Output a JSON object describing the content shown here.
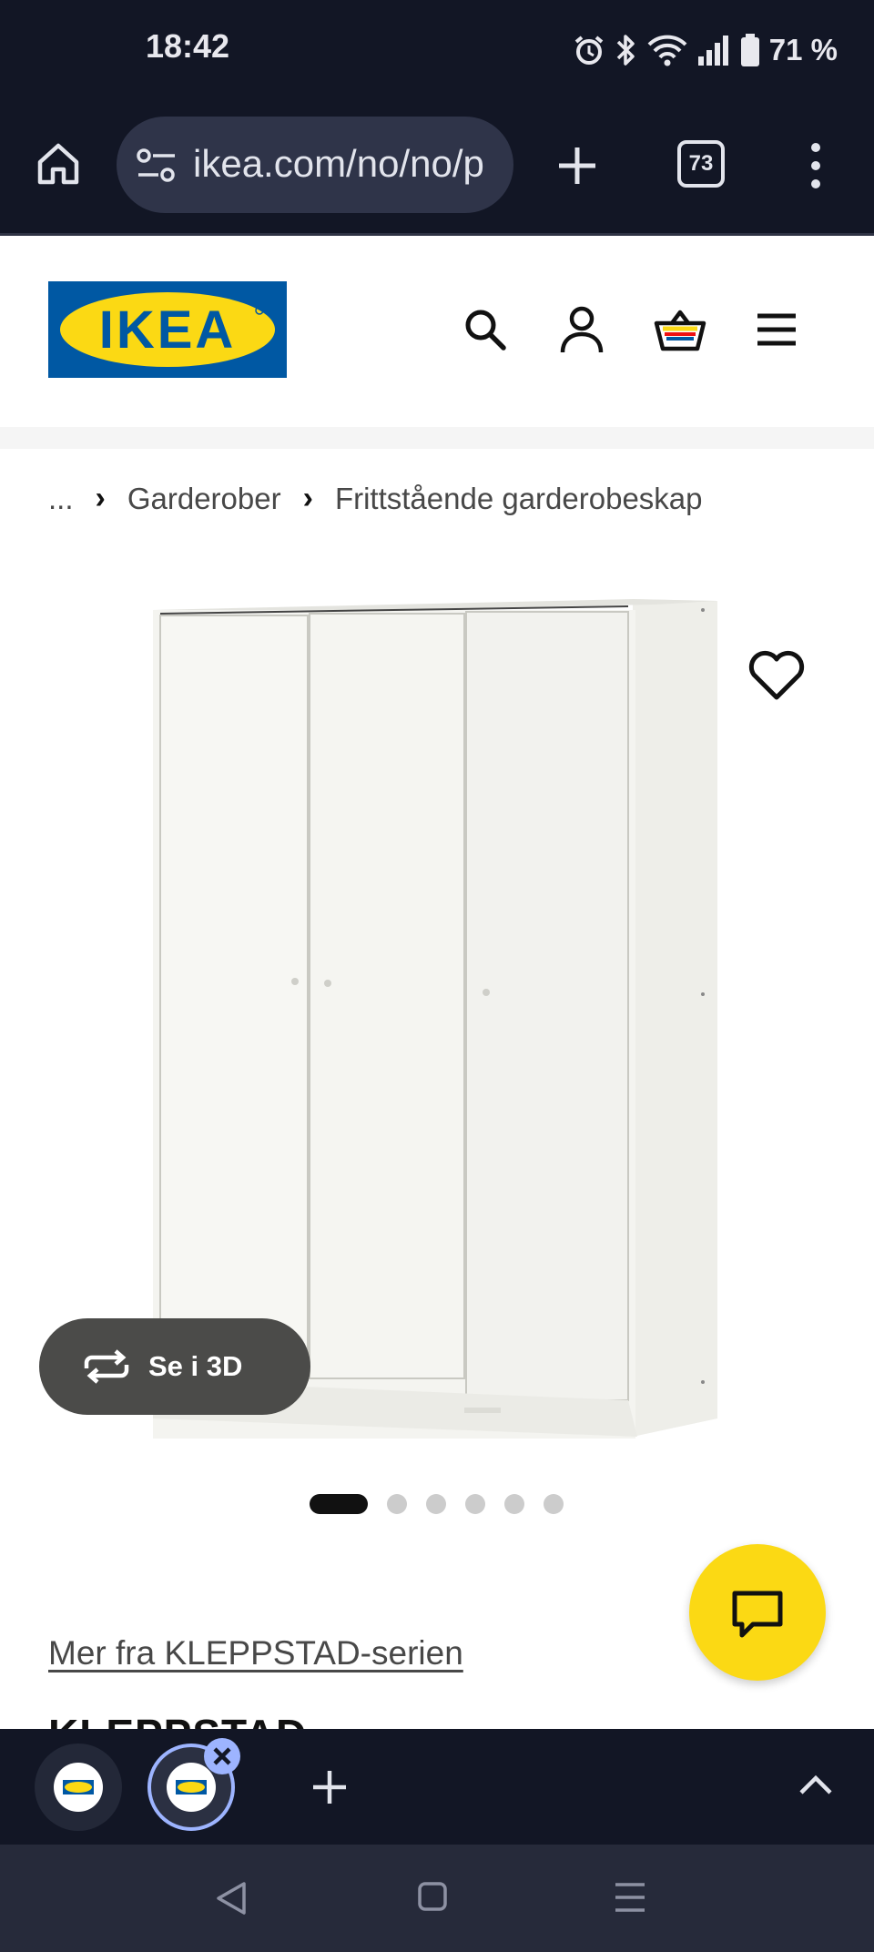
{
  "status_bar": {
    "time": "18:42",
    "battery": "71 %",
    "icons": [
      "alarm-icon",
      "bluetooth-icon",
      "wifi-icon",
      "signal-icon",
      "battery-icon"
    ]
  },
  "browser": {
    "url": "ikea.com/no/no/p",
    "tab_count": "73",
    "icons": [
      "home-icon",
      "site-settings-icon",
      "new-tab-icon",
      "tab-switcher-icon",
      "more-menu-icon"
    ]
  },
  "site_header": {
    "logo_text": "IKEA",
    "icons": [
      "search-icon",
      "account-icon",
      "cart-icon",
      "menu-icon"
    ]
  },
  "breadcrumb": {
    "ellipsis": "...",
    "items": [
      "Garderober",
      "Frittstående garderobeskap"
    ]
  },
  "product": {
    "see_3d_label": "Se i 3D",
    "carousel_count": 6,
    "carousel_active": 0,
    "series_link": "Mer fra KLEPPSTAD-serien",
    "name_peek": "KLEPPSTAD"
  },
  "colors": {
    "ikea_blue": "#0058a3",
    "ikea_yellow": "#fbd914",
    "browser_dark": "#121625"
  }
}
